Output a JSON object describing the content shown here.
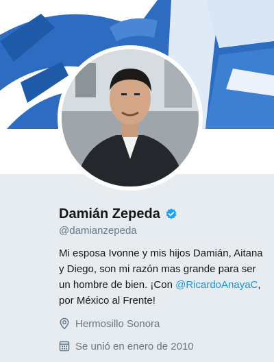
{
  "profile": {
    "name": "Damián Zepeda",
    "handle": "@damianzepeda",
    "bio_part1": "Mi esposa Ivonne y mis hijos Damián, Aitana y Diego, son mi razón mas grande para ser un hombre de bien. ¡Con ",
    "bio_mention": "@RicardoAnayaC",
    "bio_part2": ", por México al Frente!",
    "location": "Hermosillo Sonora",
    "joined": "Se unió en enero de 2010"
  },
  "colors": {
    "accent": "#1b95e0",
    "banner_blue": "#2f6fc4",
    "verified": "#1da1f2",
    "secondary_text": "#657786"
  },
  "icons": {
    "verified": "verified-badge-icon",
    "location": "location-pin-icon",
    "calendar": "calendar-icon"
  }
}
